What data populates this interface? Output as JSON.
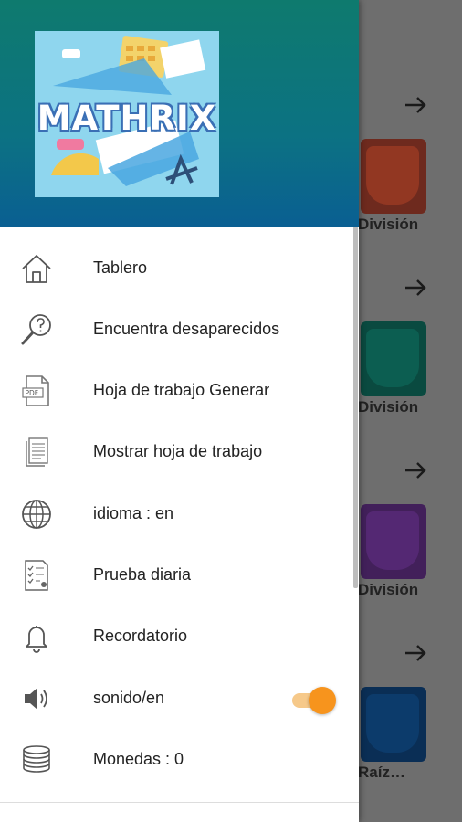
{
  "header": {
    "logo_text": "MATHRIX",
    "colors": {
      "top": "#0e7a6e",
      "bottom": "#0a5f92"
    }
  },
  "menu": [
    {
      "label": "Tablero",
      "icon": "home-icon"
    },
    {
      "label": "Encuentra desaparecidos",
      "icon": "search-question-icon"
    },
    {
      "label": "Hoja de trabajo Generar",
      "icon": "pdf-icon"
    },
    {
      "label": "Mostrar hoja de trabajo",
      "icon": "document-icon"
    },
    {
      "label": "idioma : en",
      "icon": "globe-icon"
    },
    {
      "label": "Prueba diaria",
      "icon": "checklist-icon"
    },
    {
      "label": "Recordatorio",
      "icon": "bell-icon"
    },
    {
      "label": "sonido/en",
      "icon": "speaker-icon",
      "toggle_on": true
    },
    {
      "label": "Monedas : 0",
      "icon": "coins-icon"
    }
  ],
  "background": {
    "cards": [
      {
        "label": "División",
        "color": "#e04b2b",
        "icon": "divide-icon"
      },
      {
        "label": "División",
        "color": "#0d8a73",
        "icon": "divide-icon"
      },
      {
        "label": "División",
        "color": "#7b2fa8",
        "icon": "divide-icon"
      },
      {
        "label": "Raíz…",
        "color": "#0d4a8c",
        "icon": "sqrt-icon"
      }
    ]
  },
  "accent": "#f7941d"
}
